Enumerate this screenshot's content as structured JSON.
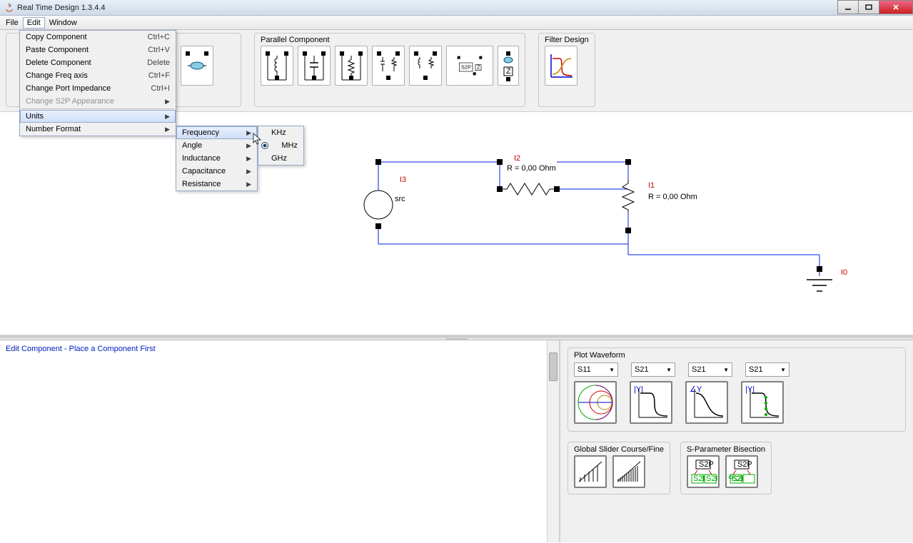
{
  "window": {
    "title": "Real Time Design 1.3.4.4"
  },
  "menubar": {
    "file": "File",
    "edit": "Edit",
    "window": "Window"
  },
  "edit_menu": {
    "copy": {
      "label": "Copy Component",
      "shortcut": "Ctrl+C"
    },
    "paste": {
      "label": "Paste Component",
      "shortcut": "Ctrl+V"
    },
    "delete": {
      "label": "Delete Component",
      "shortcut": "Delete"
    },
    "freq": {
      "label": "Change Freq axis",
      "shortcut": "Ctrl+F"
    },
    "port": {
      "label": "Change Port Impedance",
      "shortcut": "Ctrl+I"
    },
    "s2p": {
      "label": "Change S2P Appearance"
    },
    "units": {
      "label": "Units"
    },
    "numfmt": {
      "label": "Number Format"
    }
  },
  "units_menu": {
    "frequency": "Frequency",
    "angle": "Angle",
    "inductance": "Inductance",
    "capacitance": "Capacitance",
    "resistance": "Resistance"
  },
  "freq_menu": {
    "khz": "KHz",
    "mhz": "MHz",
    "ghz": "GHz"
  },
  "toolbar_groups": {
    "parallel": "Parallel Component",
    "filter": "Filter Design"
  },
  "circuit": {
    "i3": "I3",
    "src": "src",
    "i2": "I2",
    "r2": "R = 0,00 Ohm",
    "i1": "I1",
    "r1": "R = 0,00 Ohm",
    "i0": "I0"
  },
  "hint": "Edit Component - Place a Component First",
  "plot": {
    "title": "Plot Waveform",
    "s11": "S11",
    "s21_a": "S21",
    "s21_b": "S21",
    "s21_c": "S21"
  },
  "slider_group": "Global Slider Course/Fine",
  "bisect_group": "S-Parameter Bisection",
  "s2p_label": "S2P",
  "z_label": "Z"
}
